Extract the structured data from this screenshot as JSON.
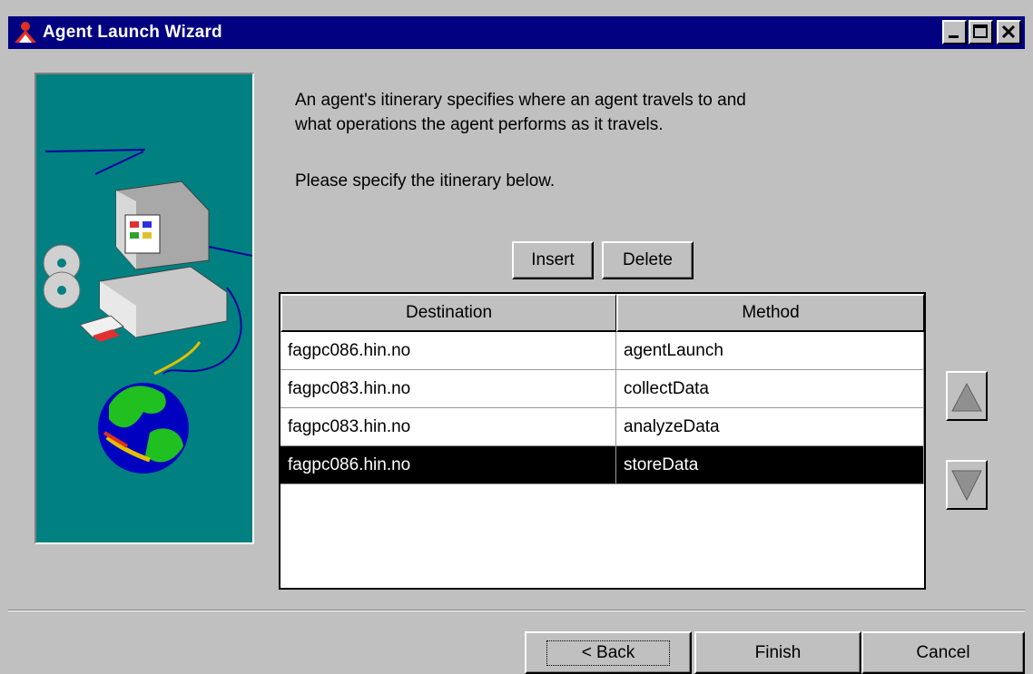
{
  "window": {
    "title": "Agent Launch Wizard",
    "icon": "agent-logo-icon",
    "controls": [
      "minimize-icon",
      "maximize-icon",
      "close-icon"
    ]
  },
  "description": {
    "line1": "An agent's itinerary specifies where an agent travels to and",
    "line2": "what operations the agent performs as it travels.",
    "prompt": "Please specify the itinerary below."
  },
  "toolbar": {
    "insert_label": "Insert",
    "delete_label": "Delete"
  },
  "itinerary": {
    "columns": [
      "Destination",
      "Method"
    ],
    "rows": [
      {
        "destination": "fagpc086.hin.no",
        "method": "agentLaunch"
      },
      {
        "destination": "fagpc083.hin.no",
        "method": "collectData"
      },
      {
        "destination": "fagpc083.hin.no",
        "method": "analyzeData"
      },
      {
        "destination": "fagpc086.hin.no",
        "method": "storeData"
      }
    ],
    "selected_row": 3
  },
  "footer": {
    "back_label": "< Back",
    "finish_label": "Finish",
    "cancel_label": "Cancel"
  },
  "colors": {
    "titlebar": "#000080",
    "window": "#c0c0c0",
    "illustration_bg": "#008080",
    "selection": "#000000"
  }
}
